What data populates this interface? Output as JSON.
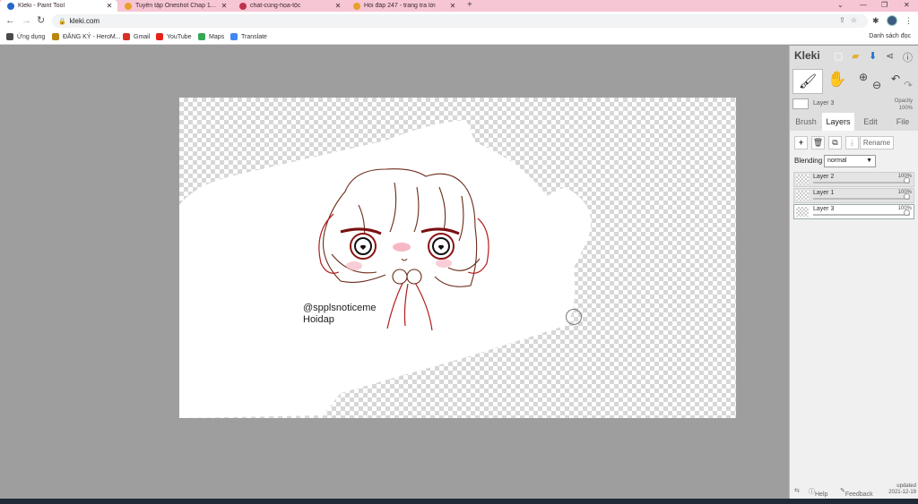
{
  "browser": {
    "tabs": [
      {
        "title": "Kleki - Paint Tool",
        "active": true,
        "favicon_color": "#2a66c9"
      },
      {
        "title": "Tuyển tập Oneshot Chap 118 N…",
        "active": false,
        "favicon_color": "#e8a02b"
      },
      {
        "title": "chat-cùng-họa-tộc",
        "active": false,
        "favicon_color": "#c0334d"
      },
      {
        "title": "Hỏi đáp 247 - trang tra lời",
        "active": false,
        "favicon_color": "#e8a02b"
      }
    ],
    "new_tab": "+",
    "window_controls": [
      "⌄",
      "—",
      "❐",
      "✕"
    ],
    "url": "kleki.com",
    "bookmarks": [
      {
        "label": "Ứng dụng",
        "color": "#4a4a4a"
      },
      {
        "label": "ĐĂNG KÝ - HeroM...",
        "color": "#b8860b"
      },
      {
        "label": "Gmail",
        "color": "#d93025"
      },
      {
        "label": "YouTube",
        "color": "#e62117"
      },
      {
        "label": "Maps",
        "color": "#34a853"
      },
      {
        "label": "Translate",
        "color": "#4285f4"
      }
    ],
    "reading_list": "Danh sách đọc"
  },
  "canvas": {
    "watermark_line1": "@spplsnoticeme",
    "watermark_line2": "Hoidap"
  },
  "kleki": {
    "logo": "Kleki",
    "active_layer": "Layer 3",
    "opacity_label": "Opacity",
    "opacity_value": "100%",
    "tabs": [
      "Brush",
      "Layers",
      "Edit",
      "File"
    ],
    "active_tab": "Layers",
    "rename_label": "Rename",
    "blending_label": "Blending",
    "blending_value": "normal",
    "layers": [
      {
        "name": "Layer 2",
        "opacity": "100%",
        "selected": false
      },
      {
        "name": "Layer 1",
        "opacity": "100%",
        "selected": false
      },
      {
        "name": "Layer 3",
        "opacity": "100%",
        "selected": true
      }
    ],
    "footer": {
      "help": "Help",
      "feedback": "Feedback",
      "updated_label": "updated",
      "updated_date": "2021-12-19"
    }
  }
}
